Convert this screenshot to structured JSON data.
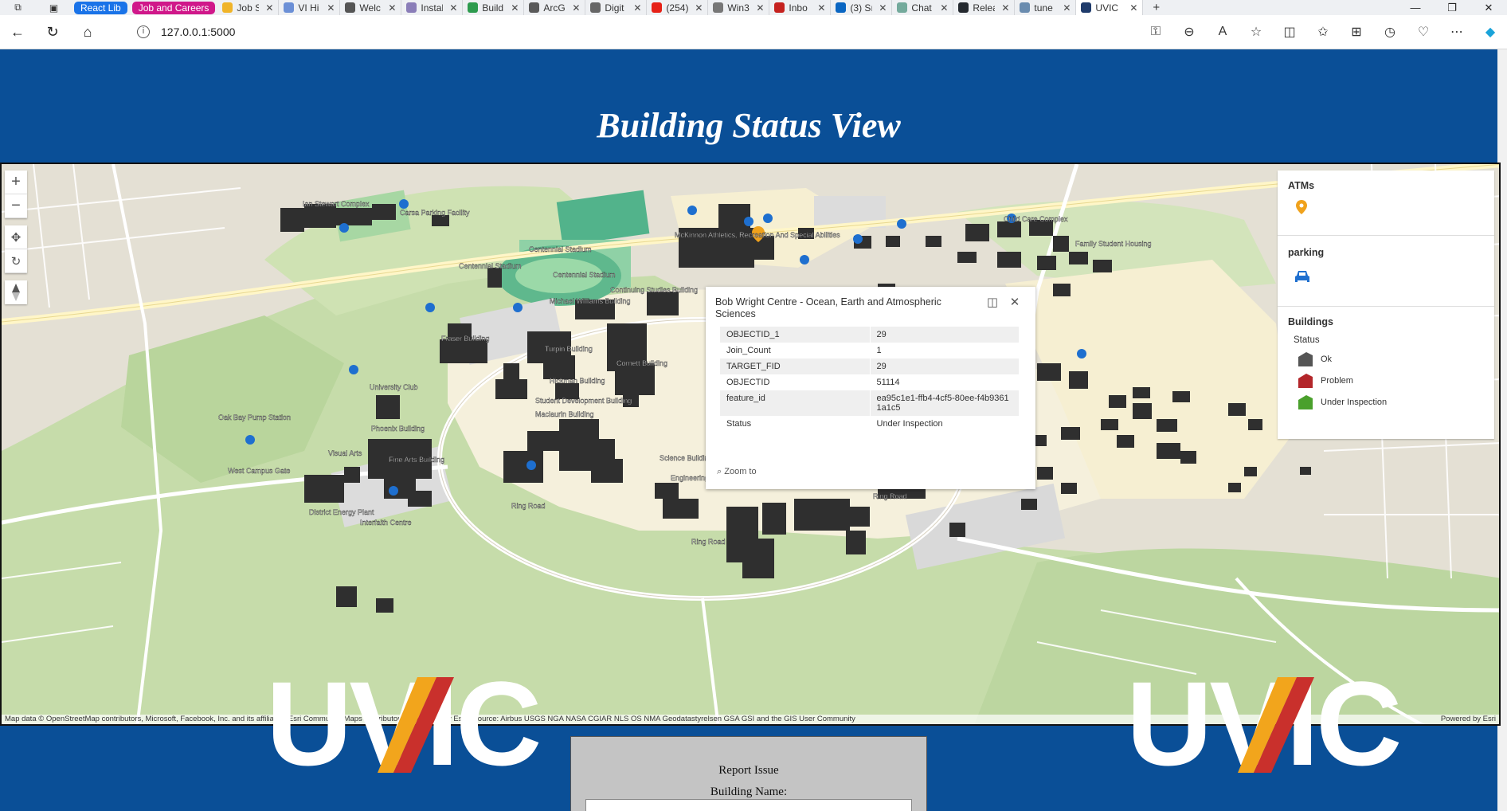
{
  "browser": {
    "tab_groups": [
      {
        "label": "React Lib",
        "color": "#1a73e8"
      },
      {
        "label": "Job and Careers",
        "color": "#d0188a"
      }
    ],
    "tabs": [
      {
        "label": "Job S",
        "color": "#f0b429"
      },
      {
        "label": "VI Hi",
        "color": "#6b8fd6"
      },
      {
        "label": "Welc",
        "color": "#555555"
      },
      {
        "label": "Instal",
        "color": "#8a7db8"
      },
      {
        "label": "Build",
        "color": "#2e9b4e"
      },
      {
        "label": "ArcGI",
        "color": "#5a5a5a"
      },
      {
        "label": "Digit",
        "color": "#666666"
      },
      {
        "label": "(254)",
        "color": "#e62117"
      },
      {
        "label": "Win3",
        "color": "#777777"
      },
      {
        "label": "Inbo",
        "color": "#c5221f"
      },
      {
        "label": "(3) Sı",
        "color": "#0a66c2"
      },
      {
        "label": "Chat",
        "color": "#74aa9c"
      },
      {
        "label": "Relea",
        "color": "#24292f"
      },
      {
        "label": "tune",
        "color": "#6a8caf"
      },
      {
        "label": "UVIC",
        "color": "#1f3b6b"
      }
    ],
    "new_tab": "+",
    "url": "127.0.0.1:5000"
  },
  "page": {
    "title": "Building Status View"
  },
  "map": {
    "zoom_in": "+",
    "zoom_out": "−",
    "labels": {
      "ian_stewart": "Ian Stewart Complex",
      "carsa": "Carsa Parking Facility",
      "mck_athletics": "McKinnon Athletics, Recreation And Special Abilities",
      "child_care": "Child Care Complex",
      "family_housing": "Family Student Housing",
      "centennial_stadium_1": "Centennial Stadium",
      "centennial_stadium_2": "Centennial Stadium",
      "centennial_stadium_3": "Centennial Stadium",
      "continuing_studies": "Continuing Studies Building",
      "michael_williams": "Michael Williams Building",
      "fraser": "Fraser Building",
      "turpin": "Turpin Building",
      "cornett": "Cornett Building",
      "hickman": "Hickman Building",
      "university_club": "University Club",
      "student_dev": "Student Development Building",
      "maclaurin": "Maclaurin Building",
      "phoenix": "Phoenix Building",
      "visual_arts": "Visual Arts",
      "fine_arts": "Fine Arts Building",
      "pump_station": "Oak Bay Pump Station",
      "ecs": "Engineering and Computer Science Building",
      "ring_road_1": "Ring Road",
      "ring_road_2": "Ring Road",
      "ring_road_3": "Ring Road",
      "west_campus": "West Campus Gate",
      "interfaith": "Interfaith Centre",
      "district_energy": "District Energy Plant",
      "science": "Science Building"
    },
    "attribution_left": "Map data © OpenStreetMap contributors, Microsoft, Facebook, Inc. and its affiliates, Esri Community Maps contributors, Map layer by Esri | Source: Airbus USGS NGA NASA CGIAR NLS OS NMA Geodatastyrelsen GSA GSI and the GIS User Community",
    "attribution_right": "Powered by Esri"
  },
  "popup": {
    "title": "Bob Wright Centre - Ocean, Earth and Atmospheric Sciences",
    "fields": [
      {
        "key": "OBJECTID_1",
        "value": "29"
      },
      {
        "key": "Join_Count",
        "value": "1"
      },
      {
        "key": "TARGET_FID",
        "value": "29"
      },
      {
        "key": "OBJECTID",
        "value": "51114"
      },
      {
        "key": "feature_id",
        "value": "ea95c1e1-ffb4-4cf5-80ee-f4b93611a1c5"
      },
      {
        "key": "Status",
        "value": "Under Inspection"
      }
    ],
    "zoom_to": "Zoom to"
  },
  "legend": {
    "atms": {
      "title": "ATMs",
      "color": "#f0a21c"
    },
    "parking": {
      "title": "parking",
      "color": "#1e6fcf"
    },
    "buildings": {
      "title": "Buildings",
      "field": "Status",
      "classes": [
        {
          "label": "Ok",
          "color": "#555555"
        },
        {
          "label": "Problem",
          "color": "#b3262a"
        },
        {
          "label": "Under Inspection",
          "color": "#4aa02c"
        }
      ]
    }
  },
  "footer": {
    "logo_text": "UVIC",
    "report_title": "Report Issue",
    "building_label": "Building Name:"
  }
}
